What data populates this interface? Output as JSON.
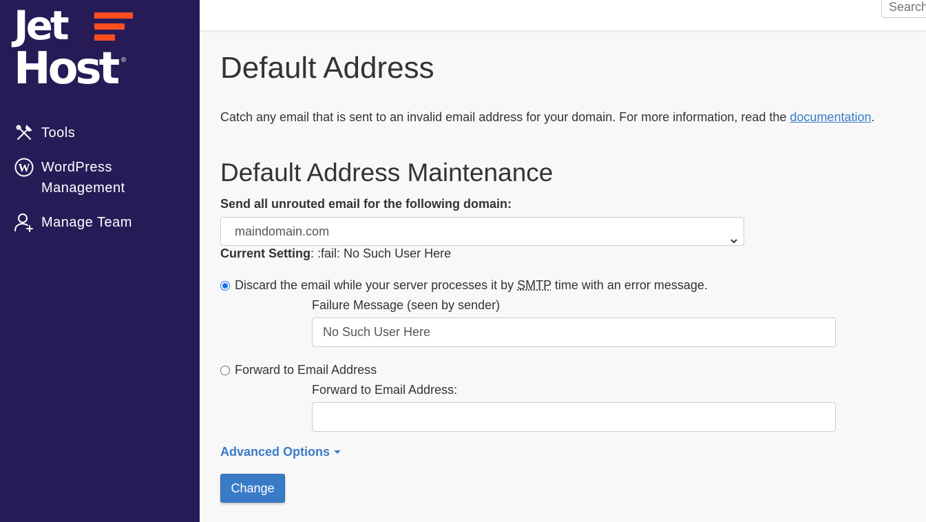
{
  "brand": {
    "logo_line1": "Jet",
    "logo_line2": "Host",
    "registered_mark": "®",
    "bar_color": "#ff4d1f",
    "sidebar_color": "#271b57"
  },
  "sidebar": {
    "items": [
      {
        "label": "Tools",
        "icon": "tools-icon"
      },
      {
        "label": "WordPress Management",
        "icon": "wordpress-icon"
      },
      {
        "label": "Manage Team",
        "icon": "add-user-icon"
      }
    ]
  },
  "topbar": {
    "search_placeholder": "Search"
  },
  "page": {
    "title": "Default Address",
    "description_prefix": "Catch any email that is sent to an invalid email address for your domain. For more information, read the ",
    "description_link": "documentation",
    "description_suffix": ".",
    "section_title": "Default Address Maintenance",
    "domain_label": "Send all unrouted email for the following domain:",
    "domain_selected": "maindomain.com",
    "current_setting_label": "Current Setting",
    "current_setting_value": ": :fail: No Such User Here",
    "option_discard": {
      "label_before": "Discard the email while your server processes it by ",
      "label_abbr": "SMTP",
      "label_after": " time with an error message.",
      "checked": true,
      "field_label": "Failure Message (seen by sender)",
      "field_value": "No Such User Here"
    },
    "option_forward": {
      "label": "Forward to Email Address",
      "checked": false,
      "field_label": "Forward to Email Address:",
      "field_value": ""
    },
    "advanced_options_label": "Advanced Options",
    "change_button_label": "Change"
  }
}
